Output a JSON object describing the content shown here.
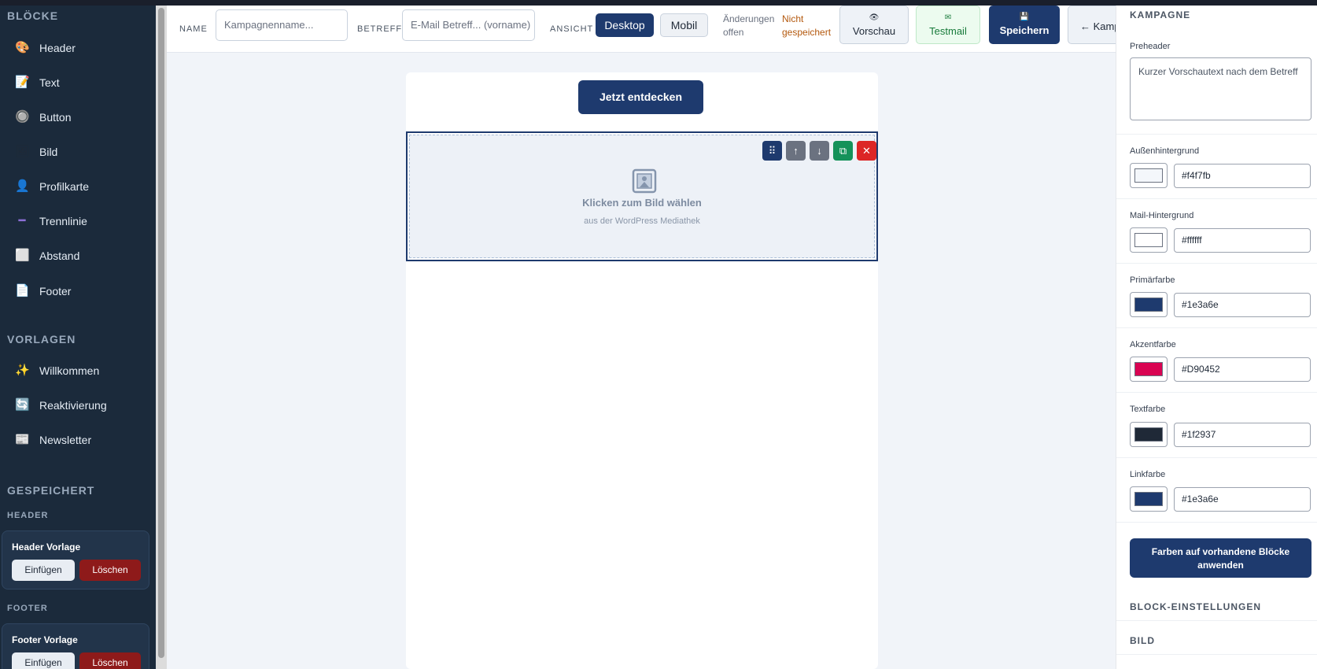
{
  "sidebar": {
    "blocks_title": "BLÖCKE",
    "blocks": [
      {
        "label": "Header",
        "icon": "palette-icon",
        "glyph": "🎨"
      },
      {
        "label": "Text",
        "icon": "memo-icon",
        "glyph": "📝"
      },
      {
        "label": "Button",
        "icon": "radio-button-icon",
        "glyph": "🔘"
      },
      {
        "label": "Bild",
        "icon": "framed-picture-icon",
        "glyph": "🖼"
      },
      {
        "label": "Profilkarte",
        "icon": "person-icon",
        "glyph": "👤"
      },
      {
        "label": "Trennlinie",
        "icon": "divider-line-icon",
        "glyph": "━"
      },
      {
        "label": "Abstand",
        "icon": "spacer-square-icon",
        "glyph": "⬜"
      },
      {
        "label": "Footer",
        "icon": "page-icon",
        "glyph": "📄"
      }
    ],
    "templates_title": "VORLAGEN",
    "templates": [
      {
        "label": "Willkommen",
        "icon": "sparkles-icon",
        "glyph": "✨"
      },
      {
        "label": "Reaktivierung",
        "icon": "refresh-icon",
        "glyph": "🔄"
      },
      {
        "label": "Newsletter",
        "icon": "newsletter-icon",
        "glyph": "📰"
      }
    ],
    "saved_title": "GESPEICHERT",
    "saved_groups": [
      {
        "heading": "HEADER",
        "card_title": "Header Vorlage",
        "insert": "Einfügen",
        "delete": "Löschen"
      },
      {
        "heading": "FOOTER",
        "card_title": "Footer Vorlage",
        "insert": "Einfügen",
        "delete": "Löschen"
      }
    ]
  },
  "toolbar": {
    "name_label": "NAME",
    "name_placeholder": "Kampagnenname...",
    "subject_label": "BETREFF",
    "subject_placeholder": "E-Mail Betreff... (vorname)",
    "view_label": "ANSICHT",
    "view_desktop": "Desktop",
    "view_mobile": "Mobil",
    "changes_line1": "Änderungen",
    "changes_line2": "offen",
    "unsaved_line1": "Nicht",
    "unsaved_line2": "gespeichert",
    "preview": "Vorschau",
    "testmail": "Testmail",
    "save": "Speichern",
    "back": "← Kampagnen"
  },
  "canvas": {
    "cta_label": "Jetzt entdecken",
    "image_click": "Klicken zum Bild wählen",
    "image_source": "aus der WordPress Mediathek",
    "controls": [
      "drag-handle-icon",
      "arrow-up-icon",
      "arrow-down-icon",
      "duplicate-icon",
      "delete-icon"
    ]
  },
  "panel": {
    "campaign_title": "KAMPAGNE",
    "preheader_label": "Preheader",
    "preheader_placeholder": "Kurzer Vorschautext nach dem Betreff",
    "colors": [
      {
        "label": "Außenhintergrund",
        "hex": "#f4f7fb"
      },
      {
        "label": "Mail-Hintergrund",
        "hex": "#ffffff"
      },
      {
        "label": "Primärfarbe",
        "hex": "#1e3a6e"
      },
      {
        "label": "Akzentfarbe",
        "hex": "#D90452"
      },
      {
        "label": "Textfarbe",
        "hex": "#1f2937"
      },
      {
        "label": "Linkfarbe",
        "hex": "#1e3a6e"
      }
    ],
    "apply_colors": "Farben auf vorhandene Blöcke anwenden",
    "block_settings_title": "BLOCK-EINSTELLUNGEN",
    "image_title": "BILD"
  }
}
